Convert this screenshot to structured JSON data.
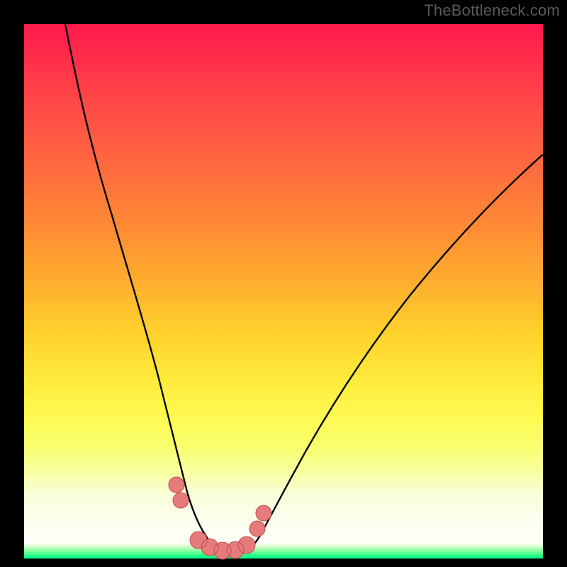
{
  "watermark": {
    "text": "TheBottleneck.com"
  },
  "colors": {
    "curve": "#000000",
    "marker_fill": "#e77a7a",
    "marker_stroke": "#b94f4f",
    "green_band": "#00ff88"
  },
  "chart_data": {
    "type": "line",
    "title": "",
    "xlabel": "",
    "ylabel": "",
    "xlim": [
      0,
      100
    ],
    "ylim": [
      0,
      100
    ],
    "grid": false,
    "legend": false,
    "annotations": [
      "TheBottleneck.com"
    ],
    "series": [
      {
        "name": "bottleneck-curve",
        "x": [
          8,
          10,
          13,
          17,
          21,
          24,
          27,
          29,
          31,
          33,
          35,
          37.5,
          40,
          45,
          52,
          60,
          70,
          82,
          95,
          100
        ],
        "values": [
          100,
          90,
          78,
          64,
          48,
          34,
          22,
          14,
          8,
          4,
          2,
          1,
          2,
          5,
          11,
          20,
          31,
          44,
          57,
          62
        ],
        "note": "values are bottleneck % — 0 at the valley floor (~x≈37), rising steeply left and moderately right"
      }
    ],
    "markers": {
      "name": "highlighted-points",
      "x": [
        29,
        30,
        33,
        35,
        37,
        38,
        40,
        42,
        43
      ],
      "values": [
        12,
        10,
        3,
        2,
        1,
        1,
        2,
        5,
        8
      ],
      "style": "round-salmon"
    }
  }
}
